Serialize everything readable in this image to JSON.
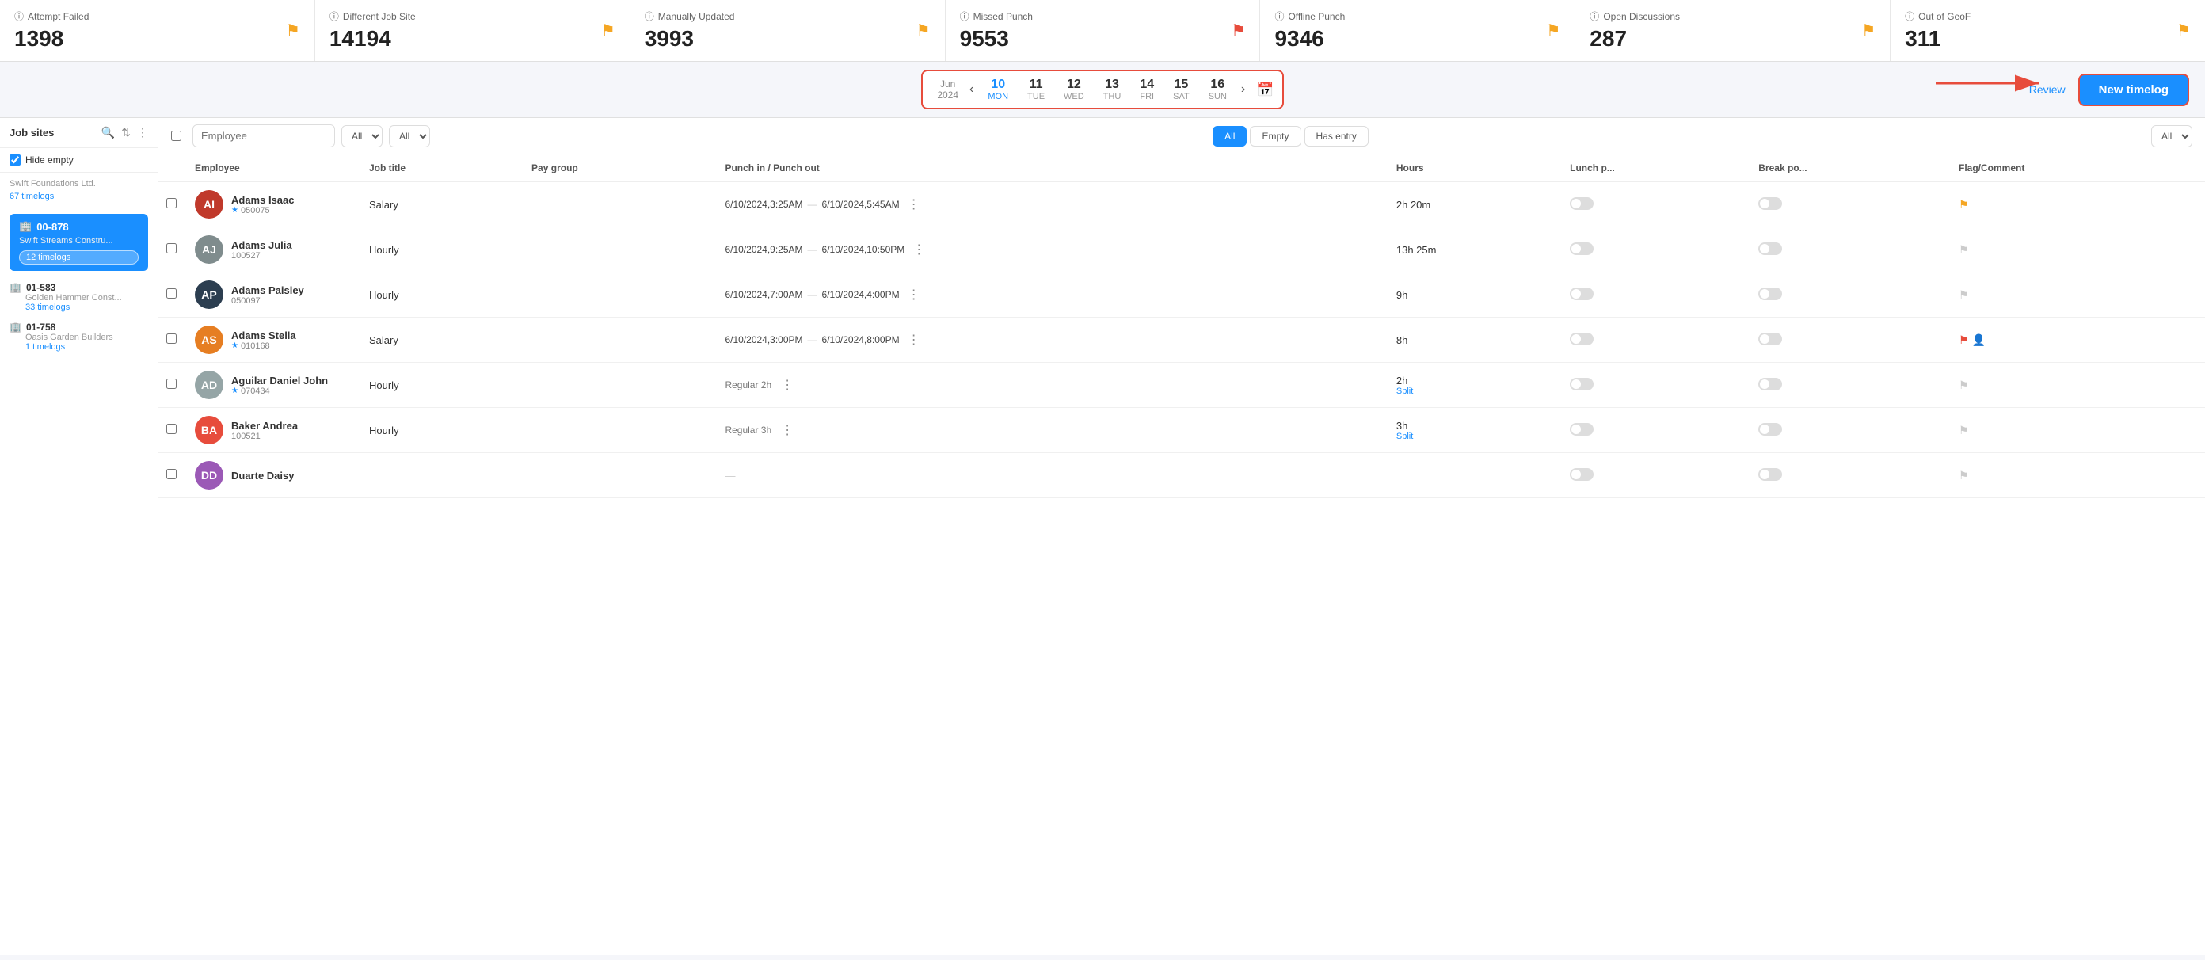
{
  "stats": [
    {
      "id": "attempt-failed",
      "title": "Attempt Failed",
      "value": "1398",
      "flag": "yellow",
      "flagType": "yellow"
    },
    {
      "id": "different-job-site",
      "title": "Different Job Site",
      "value": "14194",
      "flag": "yellow",
      "flagType": "yellow"
    },
    {
      "id": "manually-updated",
      "title": "Manually Updated",
      "value": "3993",
      "flag": "yellow",
      "flagType": "yellow"
    },
    {
      "id": "missed-punch",
      "title": "Missed Punch",
      "value": "9553",
      "flag": "red",
      "flagType": "red"
    },
    {
      "id": "offline-punch",
      "title": "Offline Punch",
      "value": "9346",
      "flag": "yellow",
      "flagType": "yellow"
    },
    {
      "id": "open-discussions",
      "title": "Open Discussions",
      "value": "287",
      "flag": "yellow",
      "flagType": "yellow"
    },
    {
      "id": "out-of-geo",
      "title": "Out of GeoF",
      "value": "311",
      "flag": "yellow",
      "flagType": "yellow"
    }
  ],
  "dateNav": {
    "monthLabel": "Jun\n2024",
    "prevArrow": "‹",
    "nextArrow": "›",
    "days": [
      {
        "num": "10",
        "name": "MON",
        "active": true
      },
      {
        "num": "11",
        "name": "TUE",
        "active": false
      },
      {
        "num": "12",
        "name": "WED",
        "active": false
      },
      {
        "num": "13",
        "name": "THU",
        "active": false
      },
      {
        "num": "14",
        "name": "FRI",
        "active": false
      },
      {
        "num": "15",
        "name": "SAT",
        "active": false
      },
      {
        "num": "16",
        "name": "SUN",
        "active": false
      }
    ],
    "reviewLabel": "Review",
    "newTimelogLabel": "New timelog"
  },
  "sidebar": {
    "title": "Job sites",
    "hideEmpty": true,
    "hideEmptyLabel": "Hide empty",
    "sites": [
      {
        "company": "Swift Foundations Ltd.",
        "timelogs": "67 timelogs",
        "active": false
      },
      {
        "code": "00-878",
        "name": "Swift Streams Constru...",
        "timelogs": "12 timelogs",
        "active": true
      },
      {
        "code": "01-583",
        "name": "Golden Hammer Const...",
        "timelogs": "33 timelogs",
        "active": false
      },
      {
        "code": "01-758",
        "name": "Oasis Garden Builders",
        "timelogs": "1 timelogs",
        "active": false
      }
    ]
  },
  "toolbar": {
    "employeePlaceholder": "Employee",
    "jobTitleDefault": "All",
    "payGroupDefault": "All",
    "filters": [
      "All",
      "Empty",
      "Has entry"
    ],
    "activeFilter": "All",
    "flagCommentDefault": "All"
  },
  "tableHeaders": [
    "",
    "",
    "Employee",
    "Job title",
    "Pay group",
    "Punch in / Punch out",
    "Hours",
    "Lunch p...",
    "Break po...",
    "Flag/Comment"
  ],
  "employees": [
    {
      "id": "adams-isaac",
      "name": "Adams Isaac",
      "empId": "050075",
      "starred": true,
      "jobTitle": "Salary",
      "payGroup": "",
      "punchIn": "6/10/2024,3:25AM",
      "punchOut": "6/10/2024,5:45AM",
      "hours": "2h 20m",
      "split": false,
      "flag": "yellow",
      "avatarColor": "#c0392b",
      "avatarInitials": "AI"
    },
    {
      "id": "adams-julia",
      "name": "Adams Julia",
      "empId": "100527",
      "starred": false,
      "jobTitle": "Hourly",
      "payGroup": "",
      "punchIn": "6/10/2024,9:25AM",
      "punchOut": "6/10/2024,10:50PM",
      "hours": "13h 25m",
      "split": false,
      "flag": "grey",
      "avatarColor": "#7f8c8d",
      "avatarInitials": "AJ"
    },
    {
      "id": "adams-paisley",
      "name": "Adams Paisley",
      "empId": "050097",
      "starred": false,
      "jobTitle": "Hourly",
      "payGroup": "",
      "punchIn": "6/10/2024,7:00AM",
      "punchOut": "6/10/2024,4:00PM",
      "hours": "9h",
      "split": false,
      "flag": "grey",
      "avatarColor": "#2c3e50",
      "avatarInitials": "AP"
    },
    {
      "id": "adams-stella",
      "name": "Adams Stella",
      "empId": "010168",
      "starred": true,
      "jobTitle": "Salary",
      "payGroup": "",
      "punchIn": "6/10/2024,3:00PM",
      "punchOut": "6/10/2024,8:00PM",
      "hours": "8h",
      "split": false,
      "flag": "red",
      "hasUserIcon": true,
      "avatarColor": "#e67e22",
      "avatarInitials": "AS"
    },
    {
      "id": "aguilar-daniel",
      "name": "Aguilar Daniel John",
      "empId": "070434",
      "starred": true,
      "jobTitle": "Hourly",
      "payGroup": "",
      "punchIn": "",
      "punchOut": "",
      "regularLabel": "Regular 2h",
      "hours": "2h",
      "split": true,
      "flag": "grey",
      "avatarColor": "#95a5a6",
      "avatarInitials": "AD"
    },
    {
      "id": "baker-andrea",
      "name": "Baker Andrea",
      "empId": "100521",
      "starred": false,
      "jobTitle": "Hourly",
      "payGroup": "",
      "punchIn": "",
      "punchOut": "",
      "regularLabel": "Regular 3h",
      "hours": "3h",
      "split": true,
      "flag": "grey",
      "avatarColor": "#e74c3c",
      "avatarInitials": "BA"
    },
    {
      "id": "duarte-daisy",
      "name": "Duarte Daisy",
      "empId": "",
      "starred": false,
      "jobTitle": "",
      "payGroup": "",
      "punchIn": "",
      "punchOut": "",
      "regularLabel": "",
      "hours": "",
      "split": false,
      "flag": "grey",
      "avatarColor": "#9b59b6",
      "avatarInitials": "DD"
    }
  ]
}
